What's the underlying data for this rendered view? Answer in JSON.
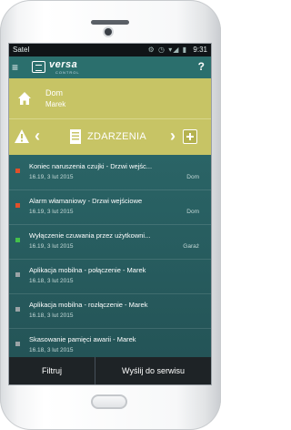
{
  "status_bar": {
    "carrier": "Satel",
    "icons_text": "⚙ ◷ ▾◢ ▮",
    "time": "9:31"
  },
  "header": {
    "logo_text": "versa",
    "logo_subtext": "CONTROL",
    "help_label": "?"
  },
  "location": {
    "title": "Dom",
    "subtitle": "Marek"
  },
  "section": {
    "title": "ZDARZENIA"
  },
  "events": [
    {
      "title": "Koniec naruszenia czujki - Drzwi wejśc...",
      "time": "16.19, 3 lut 2015",
      "place": "Dom",
      "color": "#e0502a"
    },
    {
      "title": "Alarm włamaniowy - Drzwi wejściowe",
      "time": "16.19, 3 lut 2015",
      "place": "Dom",
      "color": "#e0502a"
    },
    {
      "title": "Wyłączenie czuwania przez użytkowni...",
      "time": "16.19, 3 lut 2015",
      "place": "Garaż",
      "color": "#44c04a"
    },
    {
      "title": "Aplikacja mobilna - połączenie - Marek",
      "time": "16.18, 3 lut 2015",
      "place": "",
      "color": "#9aa3a6"
    },
    {
      "title": "Aplikacja mobilna - rozłączenie - Marek",
      "time": "16.18, 3 lut 2015",
      "place": "",
      "color": "#9aa3a6"
    },
    {
      "title": "Skasowanie pamięci awarii - Marek",
      "time": "16.18, 3 lut 2015",
      "place": "",
      "color": "#9aa3a6"
    }
  ],
  "bottom": {
    "filter_label": "Filtruj",
    "send_label": "Wyślij do serwisu"
  },
  "colors": {
    "accent": "#c7c465",
    "header": "#2b6f6d",
    "list_bg": "#244f53"
  }
}
